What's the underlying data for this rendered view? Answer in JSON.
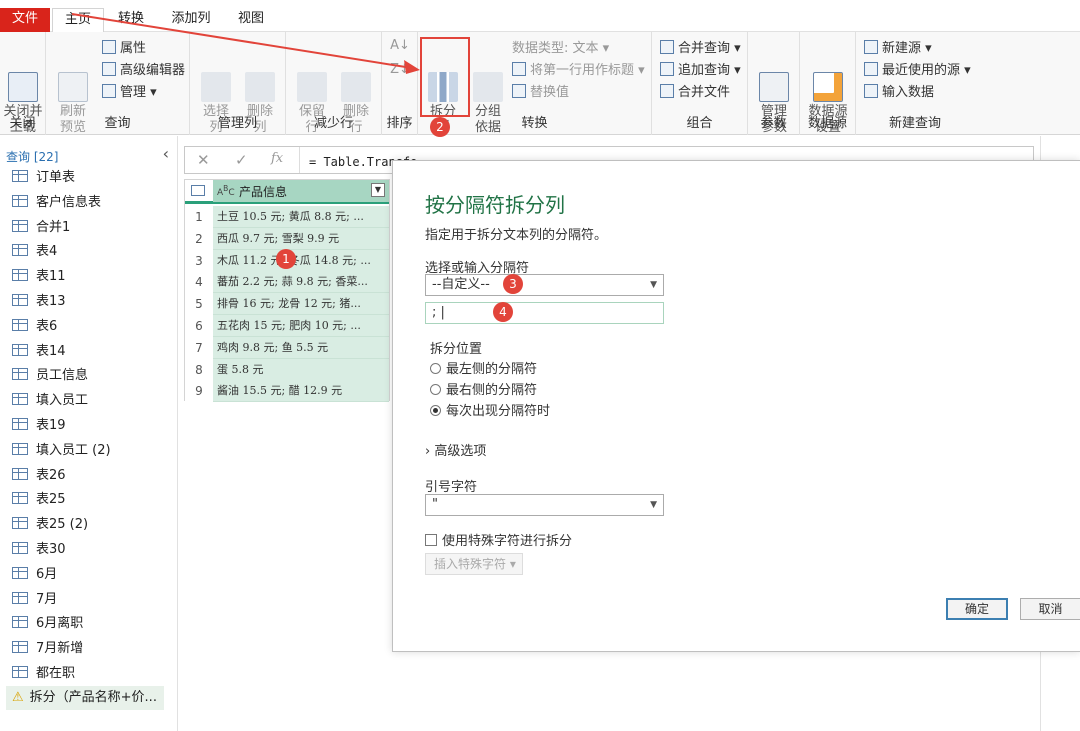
{
  "tabs": {
    "file": "文件",
    "home": "主页",
    "transform": "转换",
    "add_column": "添加列",
    "view": "视图"
  },
  "ribbon": {
    "close": {
      "btn": "关闭并\n上载",
      "label": "关闭"
    },
    "query": {
      "refresh": "刷新\n预览",
      "properties": "属性",
      "advanced_editor": "高级编辑器",
      "manage": "管理",
      "label": "查询"
    },
    "manage_columns": {
      "choose": "选择\n列",
      "remove": "删除\n列",
      "label": "管理列"
    },
    "reduce_rows": {
      "keep": "保留\n行",
      "remove": "删除\n行",
      "label": "减少行"
    },
    "sort": {
      "label": "排序"
    },
    "transform": {
      "split": "拆分\n列",
      "group_by": "分组\n依据",
      "data_type": "数据类型: 文本",
      "first_row": "将第一行用作标题",
      "replace": "替换值",
      "label": "转换"
    },
    "combine": {
      "merge": "合并查询",
      "append": "追加查询",
      "combine_files": "合并文件",
      "label": "组合"
    },
    "params": {
      "manage": "管理\n参数",
      "label": "参数"
    },
    "datasource": {
      "settings": "数据源\n设置",
      "label": "数据源"
    },
    "new_query": {
      "new_source": "新建源",
      "recent": "最近使用的源",
      "enter_data": "输入数据",
      "label": "新建查询"
    }
  },
  "queries": {
    "header": "查询 [22]",
    "items": [
      "订单表",
      "客户信息表",
      "合并1",
      "表4",
      "表11",
      "表13",
      "表6",
      "表14",
      "员工信息",
      "填入员工",
      "表19",
      "填入员工 (2)",
      "表26",
      "表25",
      "表25 (2)",
      "表30",
      "6月",
      "7月",
      "6月离职",
      "7月新增",
      "都在职"
    ],
    "selected": "拆分（产品名称+价..."
  },
  "formula": {
    "text": "= Table.TransformColumnTypes(源,{{\"产品信息\", type text}})"
  },
  "grid": {
    "column": "产品信息",
    "rows": [
      {
        "n": "1",
        "v": "土豆 10.5 元; 黄瓜 8.8 元; ..."
      },
      {
        "n": "2",
        "v": "西瓜 9.7 元; 雪梨 9.9 元"
      },
      {
        "n": "3",
        "v": "木瓜 11.2 元; 冬瓜 14.8 元; ..."
      },
      {
        "n": "4",
        "v": "蕃茄 2.2 元; 蒜 9.8 元; 香菜..."
      },
      {
        "n": "5",
        "v": "排骨 16 元; 龙骨 12 元; 猪..."
      },
      {
        "n": "6",
        "v": "五花肉 15 元; 肥肉 10 元; ..."
      },
      {
        "n": "7",
        "v": "鸡肉 9.8 元; 鱼 5.5 元"
      },
      {
        "n": "8",
        "v": "蛋 5.8 元"
      },
      {
        "n": "9",
        "v": "酱油 15.5 元; 醋 12.9 元"
      }
    ]
  },
  "dialog": {
    "title": "按分隔符拆分列",
    "subtitle": "指定用于拆分文本列的分隔符。",
    "delim_label": "选择或输入分隔符",
    "delim_value": "--自定义--",
    "custom_value": ";",
    "position_label": "拆分位置",
    "opt_left": "最左侧的分隔符",
    "opt_right": "最右侧的分隔符",
    "opt_each": "每次出现分隔符时",
    "advanced": "高级选项",
    "quote_label": "引号字符",
    "quote_value": "\"",
    "special_label": "使用特殊字符进行拆分",
    "insert_special": "插入特殊字符",
    "ok": "确定",
    "cancel": "取消"
  },
  "badges": [
    "1",
    "2",
    "3",
    "4"
  ],
  "colors": {
    "accent": "#217346",
    "file_tab": "#d9241b",
    "highlight": "#e2443a",
    "row_fill": "#d9ede3"
  }
}
